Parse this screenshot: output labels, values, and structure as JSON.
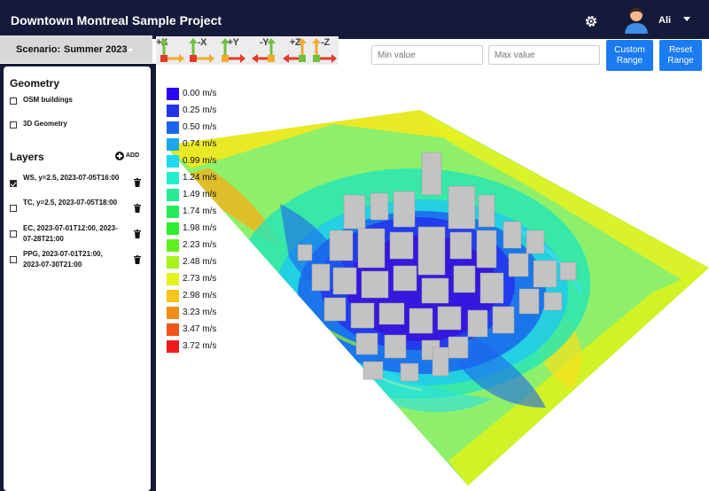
{
  "app": {
    "title": "Downtown Montreal Sample Project",
    "user": "Ali"
  },
  "icons": {
    "settings": "gear-icon",
    "avatar": "user-avatar-icon",
    "user_menu": "chevron-down-icon",
    "delete": "trash-icon",
    "add": "plus-circle-icon"
  },
  "scenario": {
    "label": "Scenario:",
    "value": "Summer 2023"
  },
  "view_buttons": [
    "+X",
    "-X",
    "+Y",
    "-Y",
    "+Z",
    "-Z"
  ],
  "range": {
    "min_placeholder": "Min value",
    "max_placeholder": "Max value",
    "custom_label": "Custom Range",
    "reset_label": "Reset Range"
  },
  "sidebar": {
    "geometry_title": "Geometry",
    "geometry_items": [
      {
        "label": "OSM buildings",
        "checked": false
      },
      {
        "label": "3D Geometry",
        "checked": false
      }
    ],
    "layers_title": "Layers",
    "add_label": "ADD",
    "layers": [
      {
        "label": "WS, y=2.5, 2023-07-05T16:00",
        "checked": true
      },
      {
        "label": "TC, y=2.5, 2023-07-05T18:00",
        "checked": false
      },
      {
        "label": "EC, 2023-07-01T12:00, 2023-07-28T21:00",
        "checked": false
      },
      {
        "label": "PPG, 2023-07-01T21:00, 2023-07-30T21:00",
        "checked": false
      }
    ]
  },
  "legend": [
    {
      "label": "0.00 m/s",
      "color": "#2a07ef"
    },
    {
      "label": "0.25 m/s",
      "color": "#2333ef"
    },
    {
      "label": "0.50 m/s",
      "color": "#1a66ec"
    },
    {
      "label": "0.74 m/s",
      "color": "#1ea7ef"
    },
    {
      "label": "0.99 m/s",
      "color": "#1fd7f0"
    },
    {
      "label": "1.24 m/s",
      "color": "#22eecd"
    },
    {
      "label": "1.49 m/s",
      "color": "#26ea96"
    },
    {
      "label": "1.74 m/s",
      "color": "#26ea5a"
    },
    {
      "label": "1.98 m/s",
      "color": "#2ced2f"
    },
    {
      "label": "2.23 m/s",
      "color": "#60f020"
    },
    {
      "label": "2.48 m/s",
      "color": "#a5f21d"
    },
    {
      "label": "2.73 m/s",
      "color": "#e6f21e"
    },
    {
      "label": "2.98 m/s",
      "color": "#f4c61b"
    },
    {
      "label": "3.23 m/s",
      "color": "#f28c18"
    },
    {
      "label": "3.47 m/s",
      "color": "#f0551a"
    },
    {
      "label": "3.72 m/s",
      "color": "#ef1b1b"
    }
  ]
}
